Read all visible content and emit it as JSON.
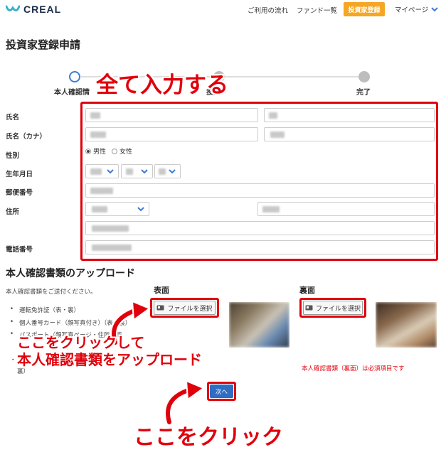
{
  "header": {
    "logo": "CREAL",
    "nav": [
      "ご利用の流れ",
      "ファンド一覧"
    ],
    "register_button": "投資家登録",
    "mypage": "マイページ"
  },
  "page_title": "投資家登録申請",
  "steps": [
    {
      "label": "本人確認情",
      "state": "current"
    },
    {
      "label": "投資",
      "state": "future"
    },
    {
      "label": "完了",
      "state": "future"
    }
  ],
  "form": {
    "labels": {
      "name": "氏名",
      "kana": "氏名（カナ）",
      "gender": "性別",
      "birthdate": "生年月日",
      "postal": "郵便番号",
      "address": "住所",
      "phone": "電話番号"
    },
    "gender_options": [
      {
        "label": "男性",
        "selected": true
      },
      {
        "label": "女性",
        "selected": false
      }
    ]
  },
  "upload": {
    "title": "本人確認書類のアップロード",
    "description": "本人確認書類をご送付ください。",
    "documents": [
      "運転免許証（表・裏）",
      "個人番号カード（顔写真付き）（表・裏）",
      "パスポート（顔写真ページ・住所記載"
    ],
    "document_fragment": "・",
    "document_fragment_2": "裏）",
    "front_label": "表面",
    "back_label": "裏面",
    "file_button": "ファイルを選択",
    "error": "本人確認書類（裏面）は必須項目です",
    "next_button": "次へ"
  },
  "annotations": {
    "fill_all": "全て入力する",
    "click_upload_line1": "ここをクリックして",
    "click_upload_line2": "本人確認書類をアップロード",
    "click_here": "ここをクリック"
  },
  "colors": {
    "accent_red": "#e0000b",
    "brand_blue": "#3e7bd6",
    "register_orange": "#f5a623",
    "next_button_blue": "#2e6dc2"
  },
  "icons": {
    "logo": "creal-wave-icon",
    "dropdown": "chevron-down-icon",
    "file": "id-card-icon",
    "arrow": "curved-arrow-icon"
  }
}
